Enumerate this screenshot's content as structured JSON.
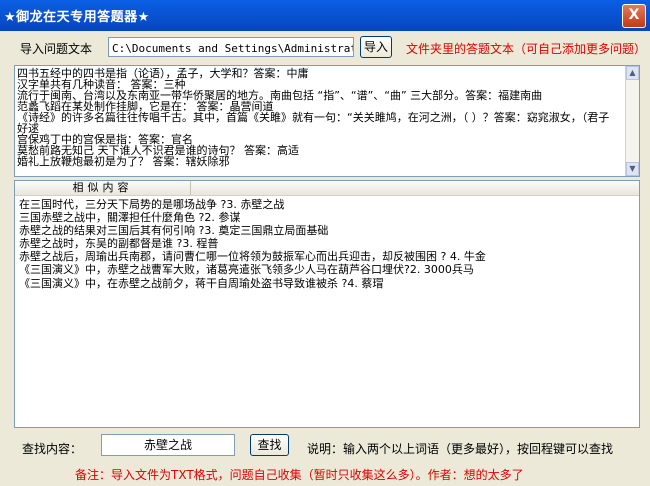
{
  "window": {
    "title": "★御龙在天专用答题器★",
    "close_glyph": "X"
  },
  "import": {
    "label": "导入问题文本",
    "path_value": "C:\\Documents and Settings\\Administrator\\桌",
    "button": "导入",
    "hint": "文件夹里的答题文本（可自己添加更多问题）"
  },
  "questions": [
    "四书五经中的四书是指（论语），孟子，大学和？答案：中庸",
    "汉字单共有几种读音：  答案：三种",
    "流行于闽南、台湾以及东南亚一带华侨聚居的地方。南曲包括 “指”、“谱”、“曲” 三大部分。答案：福建南曲",
    "范蠡飞蹈在某处制作挂脚，它是在：   答案：晶营间道",
    "《诗经》的许多名篇往往传唱千古。其中，首篇《关雎》就有一句：“关关雎鸠，在河之洲，（  ）？答案：窈窕淑女，（君子",
    "好逑",
    "宫保鸡丁中的宫保是指：答案：官名",
    "莫愁前路无知己  天下谁人不识君是谁的诗句？    答案：高适",
    "婚礼上放鞭炮最初是为了？  答案：辖妖除邪"
  ],
  "similar": {
    "header": "相似内容",
    "rows": [
      "在三国时代，三分天下局势的是哪场战争 ?3.    赤壁之战",
      "三国赤壁之战中，關澤担任什麼角色 ?2.    参谋",
      "赤壁之战的结果对三国后其有何引响 ?3.    奠定三国鼎立局面基础",
      "赤壁之战时，东吴的副都督是谁 ?3.    程普",
      "赤壁之战后，周瑜出兵南郡，请问曹仁哪一位将领为鼓振军心而出兵迎击，却反被围困 ?  4.    牛金",
      "《三国演义》中，赤壁之战曹军大败，诸葛亮遣张飞领多少人马在葫芦谷口埋伏?2.    3000兵马",
      "《三国演义》中，在赤壁之战前夕，蒋干自周瑜处盗书导致谁被杀 ?4.    蔡瑁"
    ]
  },
  "search": {
    "label": "查找内容：",
    "value": "赤壁之战",
    "button": "查找",
    "hint": "说明：输入两个以上词语（更多最好），按回程键可以查找"
  },
  "footer": {
    "note": "备注：导入文件为TXT格式，问题自己收集（暂时只收集这么多）。作者：想的太多了"
  },
  "colors": {
    "title_bar": "#0a54d6",
    "hint_red": "#e00000",
    "window_bg": "#ece9d8"
  }
}
